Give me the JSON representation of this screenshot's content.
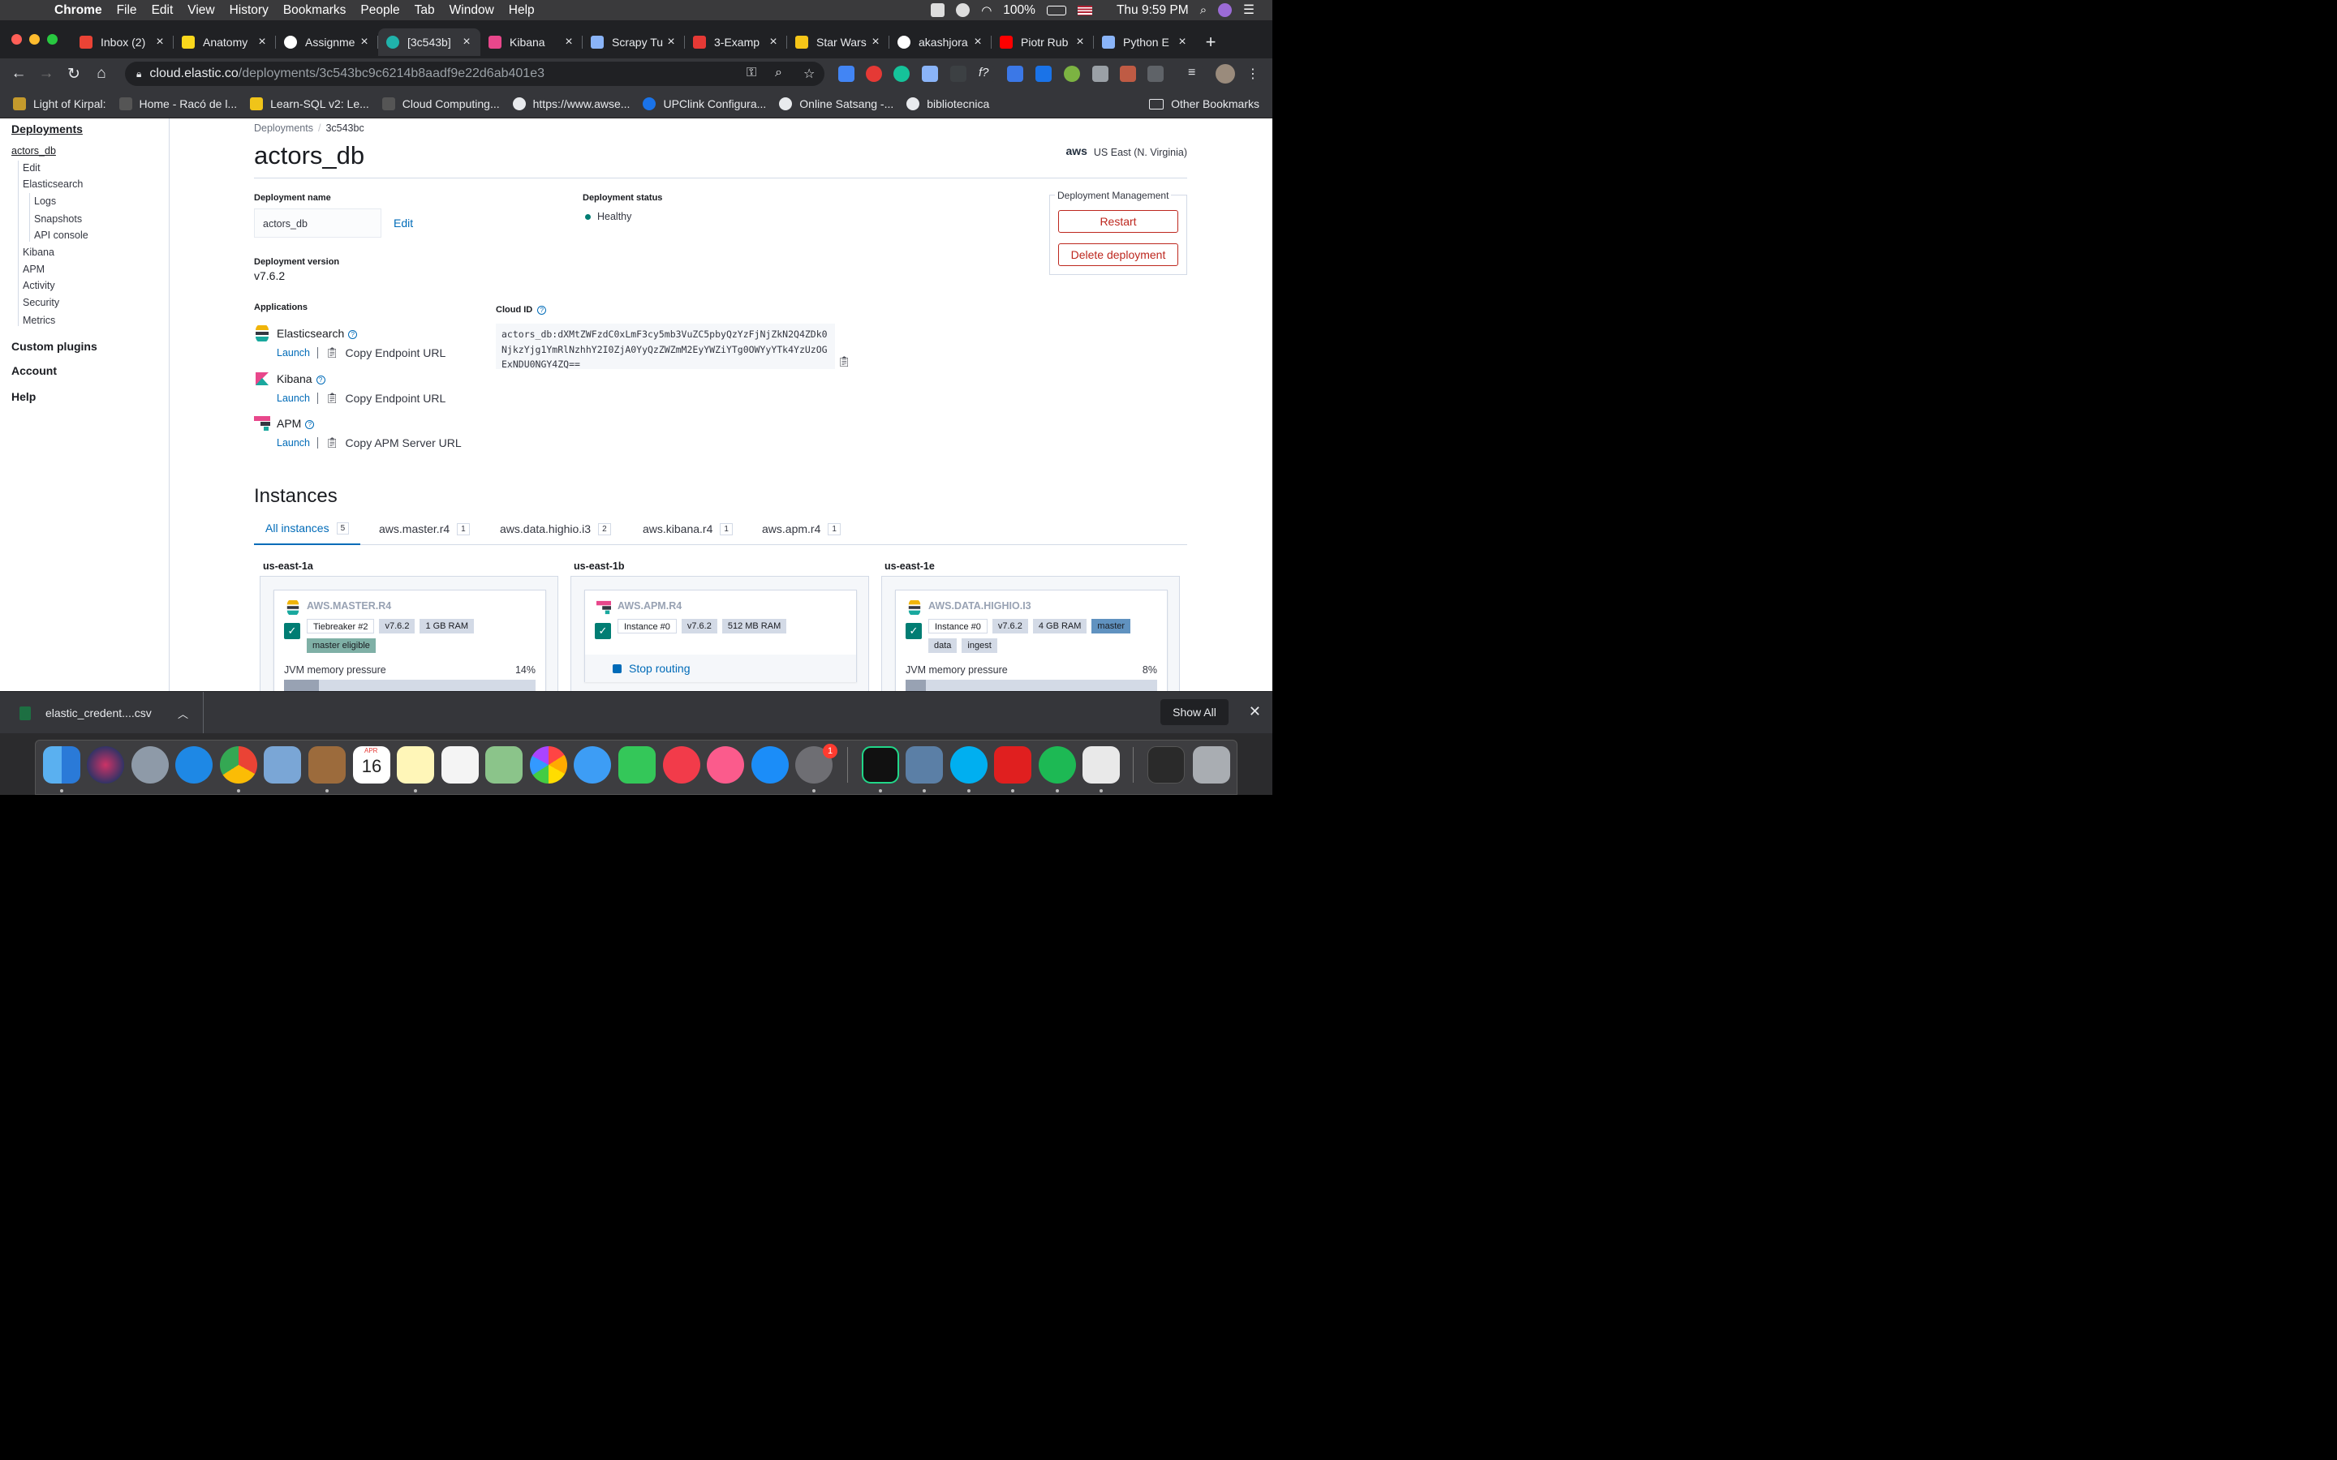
{
  "menubar": {
    "app": "Chrome",
    "items": [
      "File",
      "Edit",
      "View",
      "History",
      "Bookmarks",
      "People",
      "Tab",
      "Window",
      "Help"
    ],
    "battery": "100%",
    "clock": "Thu 9:59 PM"
  },
  "tabs": [
    {
      "title": "Inbox (2)",
      "color": "#ea4335"
    },
    {
      "title": "Anatomy",
      "color": "#f9d71c"
    },
    {
      "title": "Assignme",
      "color": "#ffffff"
    },
    {
      "title": "[3c543b]",
      "color": "#20b2aa"
    },
    {
      "title": "Kibana",
      "color": "#e8478b"
    },
    {
      "title": "Scrapy Tu",
      "color": "#8ab4f8"
    },
    {
      "title": "3-Examp",
      "color": "#e53935"
    },
    {
      "title": "Star Wars",
      "color": "#f5c518"
    },
    {
      "title": "akashjora",
      "color": "#ffffff"
    },
    {
      "title": "Piotr Rub",
      "color": "#ff0000"
    },
    {
      "title": "Python E",
      "color": "#8ab4f8"
    }
  ],
  "omnibox": {
    "host": "cloud.elastic.co",
    "path": "/deployments/3c543bc9c6214b8aadf9e22d6ab401e3"
  },
  "bookmarks": [
    {
      "label": "Light of Kirpal:",
      "color": "#c49a2c"
    },
    {
      "label": "Home - Racó de l...",
      "color": "#555"
    },
    {
      "label": "Learn-SQL v2: Le...",
      "color": "#f0c419"
    },
    {
      "label": "Cloud Computing...",
      "color": "#555"
    },
    {
      "label": "https://www.awse...",
      "color": "#e8eaed"
    },
    {
      "label": "UPClink Configura...",
      "color": "#1a73e8"
    },
    {
      "label": "Online Satsang -...",
      "color": "#e8eaed"
    },
    {
      "label": "bibliotecnica",
      "color": "#e8eaed"
    }
  ],
  "bookmarks_other": "Other Bookmarks",
  "sidenav": {
    "deployments": "Deployments",
    "deployment": "actors_db",
    "edit": "Edit",
    "elasticsearch": "Elasticsearch",
    "logs": "Logs",
    "snapshots": "Snapshots",
    "api_console": "API console",
    "kibana": "Kibana",
    "apm": "APM",
    "activity": "Activity",
    "security": "Security",
    "metrics": "Metrics",
    "custom_plugins": "Custom plugins",
    "account": "Account",
    "help": "Help"
  },
  "breadcrumb": {
    "root": "Deployments",
    "current": "3c543bc"
  },
  "title": "actors_db",
  "region": {
    "provider": "aws",
    "label": "US East (N. Virginia)"
  },
  "deployment_name": {
    "label": "Deployment name",
    "value": "actors_db",
    "edit": "Edit"
  },
  "deployment_status": {
    "label": "Deployment status",
    "value": "Healthy",
    "color": "#017d73"
  },
  "deployment_version": {
    "label": "Deployment version",
    "value": "v7.6.2"
  },
  "management": {
    "legend": "Deployment Management",
    "restart": "Restart",
    "delete": "Delete deployment"
  },
  "applications": {
    "label": "Applications",
    "items": [
      {
        "name": "Elasticsearch",
        "launch": "Launch",
        "copy": "Copy Endpoint URL"
      },
      {
        "name": "Kibana",
        "launch": "Launch",
        "copy": "Copy Endpoint URL"
      },
      {
        "name": "APM",
        "launch": "Launch",
        "copy": "Copy APM Server URL"
      }
    ]
  },
  "cloud_id": {
    "label": "Cloud ID",
    "value": "actors_db:dXMtZWFzdC0xLmF3cy5mb3VuZC5pbyQzYzFjNjZkN2Q4ZDk0NjkzYjg1YmRlNzhhY2I0ZjA0YyQzZWZmM2EyYWZiYTg0OWYyYTk4YzUzOGExNDU0NGY4ZQ=="
  },
  "instances": {
    "title": "Instances",
    "tabs": [
      {
        "label": "All instances",
        "count": "5"
      },
      {
        "label": "aws.master.r4",
        "count": "1"
      },
      {
        "label": "aws.data.highio.i3",
        "count": "2"
      },
      {
        "label": "aws.kibana.r4",
        "count": "1"
      },
      {
        "label": "aws.apm.r4",
        "count": "1"
      }
    ],
    "zones": [
      {
        "zone": "us-east-1a",
        "name": "AWS.MASTER.R4",
        "badges": [
          "Tiebreaker #2",
          "v7.6.2",
          "1 GB RAM"
        ],
        "roles": [
          "master eligible"
        ],
        "jvm_label": "JVM memory pressure",
        "jvm_pct": "14%",
        "jvm_value": 14
      },
      {
        "zone": "us-east-1b",
        "name": "AWS.APM.R4",
        "badges": [
          "Instance #0",
          "v7.6.2",
          "512 MB RAM"
        ],
        "stop_routing": "Stop routing"
      },
      {
        "zone": "us-east-1e",
        "name": "AWS.DATA.HIGHIO.I3",
        "badges": [
          "Instance #0",
          "v7.6.2",
          "4 GB RAM"
        ],
        "roles": [
          "master",
          "data",
          "ingest"
        ],
        "jvm_label": "JVM memory pressure",
        "jvm_pct": "8%",
        "jvm_value": 8
      }
    ]
  },
  "download": {
    "file": "elastic_credent....csv",
    "show_all": "Show All"
  },
  "dock": {
    "calendar_month": "APR",
    "calendar_day": "16",
    "badge": "1"
  }
}
